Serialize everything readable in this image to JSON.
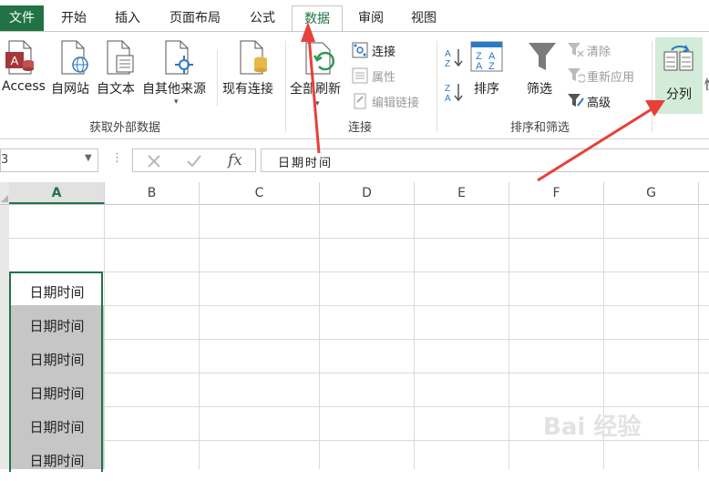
{
  "tabs": [
    {
      "label": "文件"
    },
    {
      "label": "开始"
    },
    {
      "label": "插入"
    },
    {
      "label": "页面布局"
    },
    {
      "label": "公式"
    },
    {
      "label": "数据"
    },
    {
      "label": "审阅"
    },
    {
      "label": "视图"
    }
  ],
  "ribbon": {
    "get_external": {
      "access": "Access",
      "web": "自网站",
      "text": "自文本",
      "other": "自其他来源",
      "existing": "现有连接",
      "group_label": "获取外部数据"
    },
    "connections": {
      "refresh_all": "全部刷新",
      "connect": "连接",
      "properties": "属性",
      "edit_links": "编辑链接",
      "group_label": "连接"
    },
    "sort_filter": {
      "sort": "排序",
      "filter": "筛选",
      "clear": "清除",
      "reapply": "重新应用",
      "advanced": "高级",
      "group_label": "排序和筛选"
    },
    "data_tools": {
      "text_to_columns": "分列"
    }
  },
  "formula_bar": {
    "name_box": "3",
    "fx": "fx",
    "content": "日期时间"
  },
  "columns": [
    "A",
    "B",
    "C",
    "D",
    "E",
    "F",
    "G"
  ],
  "cells": [
    "日期时间",
    "日期时间",
    "日期时间",
    "日期时间",
    "日期时间",
    "日期时间"
  ],
  "colors": {
    "accent": "#217346",
    "arrow": "#e8403a",
    "highlight": "#d3ecd9",
    "selection": "#c6c6c6"
  }
}
